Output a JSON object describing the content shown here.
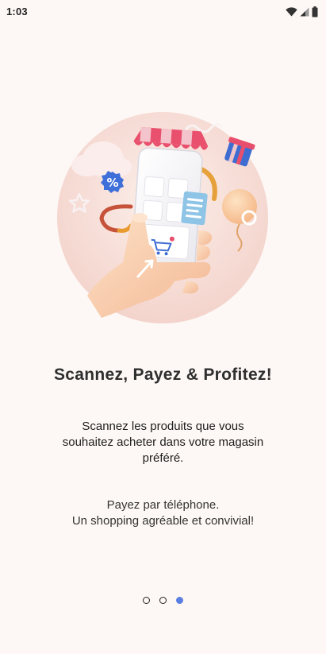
{
  "status_bar": {
    "time": "1:03",
    "icons": [
      "wifi-icon",
      "signal-icon",
      "battery-icon"
    ]
  },
  "onboarding": {
    "title": "Scannez, Payez & Profitez!",
    "description": "Scannez les produits que vous souhaitez acheter dans votre magasin préféré.",
    "subtitle_line1": "Payez par téléphone.",
    "subtitle_line2": "Un shopping agréable et convivial!",
    "illustration_badge": "%"
  },
  "pager": {
    "total": 3,
    "active_index": 2
  },
  "colors": {
    "background": "#fdf8f5",
    "accent": "#5b7fe0",
    "circle": "#f7d9d2"
  }
}
